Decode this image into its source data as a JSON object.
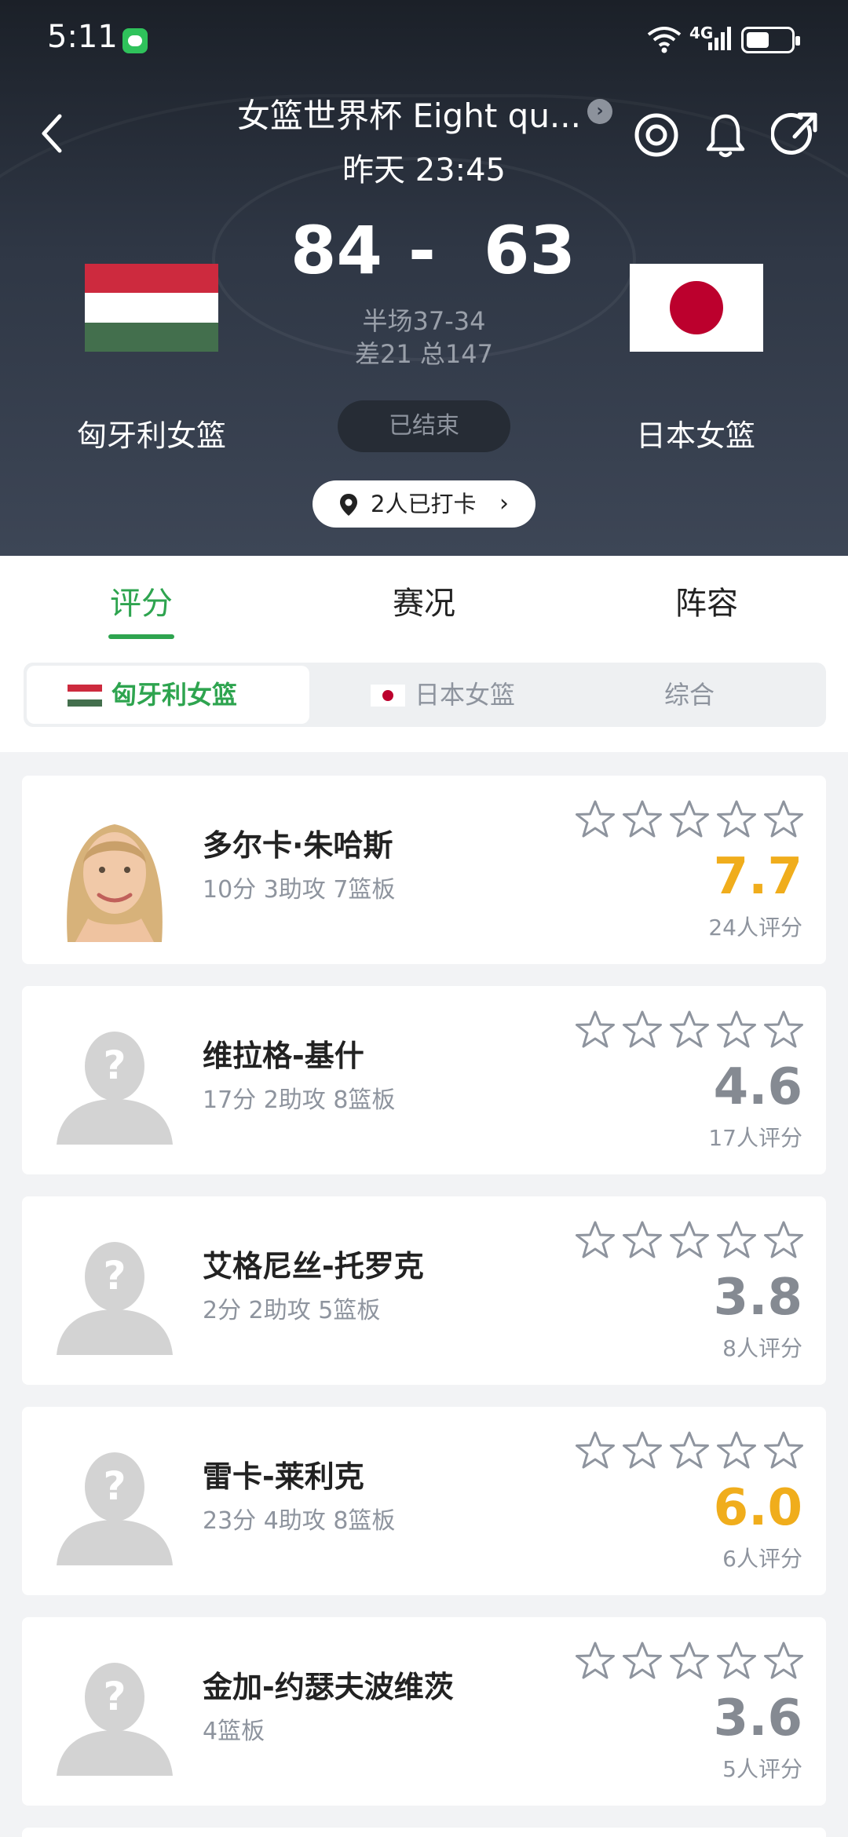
{
  "status_bar": {
    "time": "5:11",
    "network": "4G"
  },
  "header": {
    "title": "女篮世界杯 Eight qu...",
    "datetime": "昨天 23:45",
    "home_team": "匈牙利女篮",
    "away_team": "日本女篮",
    "home_score": "84",
    "score_sep": "-",
    "away_score": "63",
    "halftime": "半场37-34",
    "diff_total": "差21 总147",
    "state": "已结束",
    "checkin": "2人已打卡"
  },
  "tabs": [
    {
      "label": "评分",
      "active": true
    },
    {
      "label": "赛况",
      "active": false
    },
    {
      "label": "阵容",
      "active": false
    }
  ],
  "team_switch": {
    "home": "匈牙利女篮",
    "away": "日本女篮",
    "all": "综合"
  },
  "players": [
    {
      "name": "多尔卡·朱哈斯",
      "stats": "10分 3助攻 7篮板",
      "rating": "7.7",
      "votes": "24人评分",
      "rating_color": "#f0ad1c",
      "has_photo": true
    },
    {
      "name": "维拉格-基什",
      "stats": "17分 2助攻 8篮板",
      "rating": "4.6",
      "votes": "17人评分",
      "rating_color": "#858a92",
      "has_photo": false
    },
    {
      "name": "艾格尼丝-托罗克",
      "stats": "2分 2助攻 5篮板",
      "rating": "3.8",
      "votes": "8人评分",
      "rating_color": "#858a92",
      "has_photo": false
    },
    {
      "name": "雷卡-莱利克",
      "stats": "23分 4助攻 8篮板",
      "rating": "6.0",
      "votes": "6人评分",
      "rating_color": "#f0ad1c",
      "has_photo": false
    },
    {
      "name": "金加-约瑟夫波维茨",
      "stats": "4篮板",
      "rating": "3.6",
      "votes": "5人评分",
      "rating_color": "#858a92",
      "has_photo": false
    }
  ],
  "colors": {
    "accent": "#2ea44f",
    "highlight": "#f0ad1c",
    "muted": "#8e949e"
  },
  "icons": [
    "back-icon",
    "arrow-right-icon",
    "target-icon",
    "bell-icon",
    "share-icon",
    "location-pin-icon",
    "star-icon",
    "avatar-placeholder-icon"
  ]
}
